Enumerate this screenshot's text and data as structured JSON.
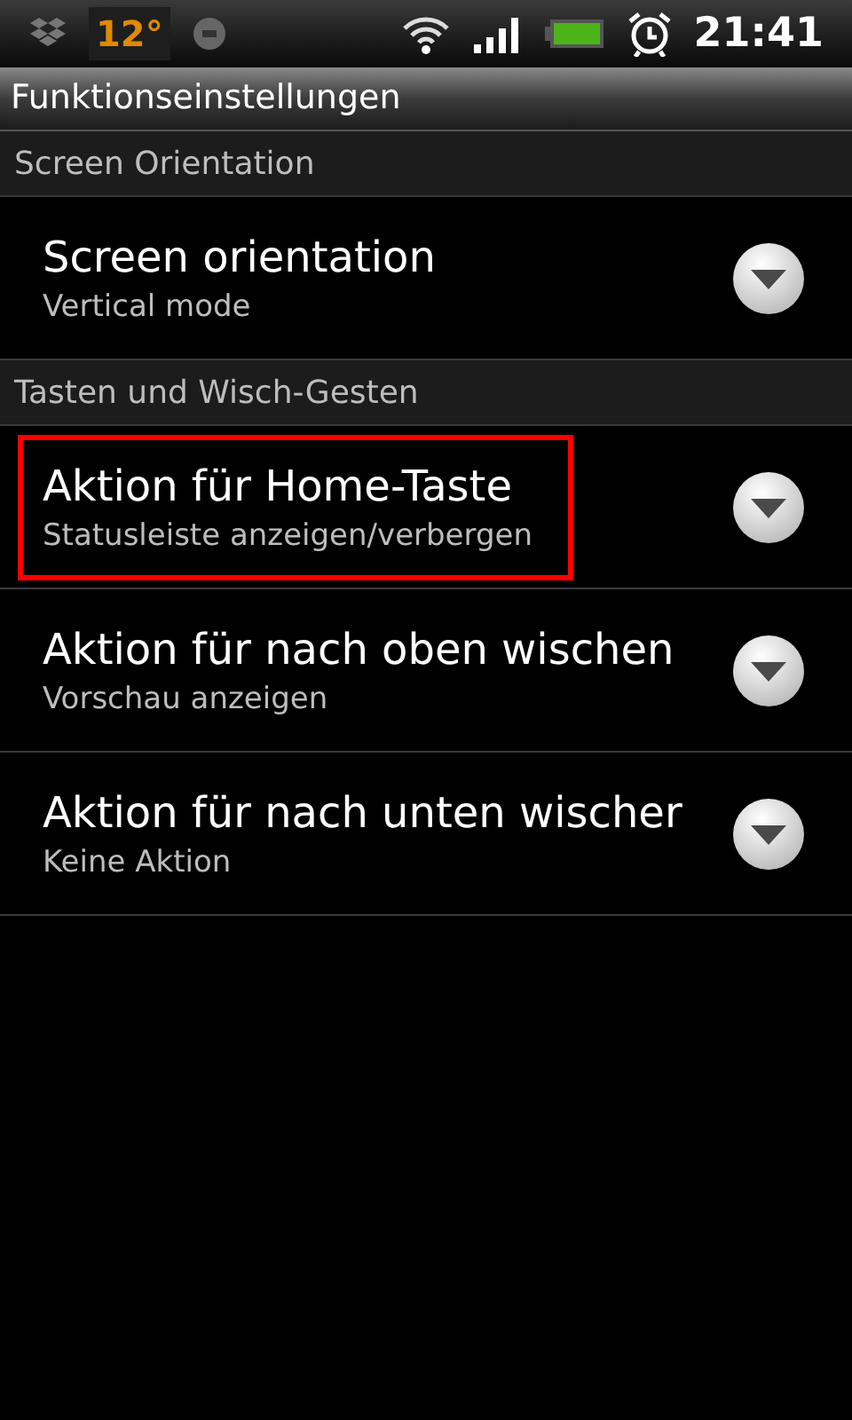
{
  "status_bar": {
    "temperature": "12°",
    "time": "21:41"
  },
  "title_bar": {
    "title": "Funktionseinstellungen"
  },
  "sections": [
    {
      "header": "Screen Orientation",
      "items": [
        {
          "title": "Screen orientation",
          "summary": "Vertical mode",
          "highlighted": false
        }
      ]
    },
    {
      "header": "Tasten und Wisch-Gesten",
      "items": [
        {
          "title": "Aktion für Home-Taste",
          "summary": "Statusleiste anzeigen/verbergen",
          "highlighted": true
        },
        {
          "title": "Aktion für nach oben wischen",
          "summary": "Vorschau anzeigen",
          "highlighted": false
        },
        {
          "title": "Aktion für nach unten wischer",
          "summary": "Keine Aktion",
          "highlighted": false
        }
      ]
    }
  ]
}
